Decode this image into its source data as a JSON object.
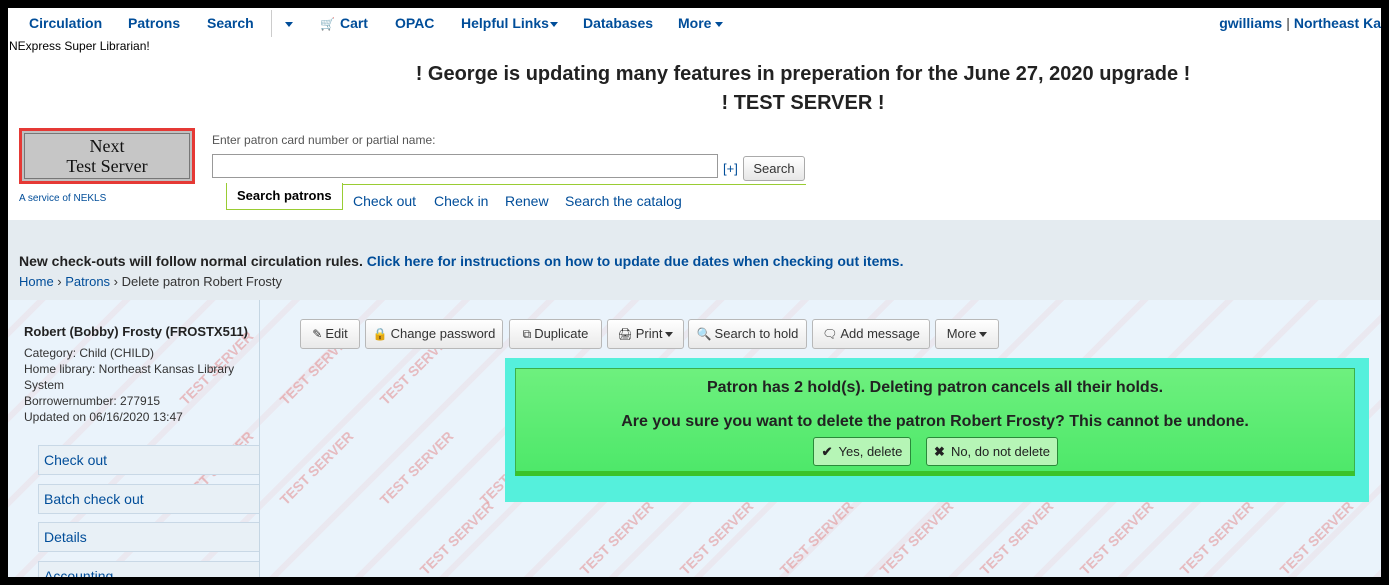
{
  "nav": {
    "circulation": "Circulation",
    "patrons": "Patrons",
    "search": "Search",
    "cart": "Cart",
    "opac": "OPAC",
    "helpful_links": "Helpful Links",
    "databases": "Databases",
    "more": "More",
    "user": "gwilliams",
    "library": "Northeast Ka"
  },
  "role": "NExpress Super Librarian!",
  "announcement": {
    "line1": "! George is updating many features in preperation for the June 27, 2020 upgrade !",
    "line2": "! TEST SERVER !"
  },
  "logo": {
    "line1": "Next",
    "line2": "Test Server",
    "service": "A service of NEKLS"
  },
  "search": {
    "label": "Enter patron card number or partial name:",
    "value": "",
    "plus": "[+]",
    "button": "Search",
    "tabs": [
      "Search patrons",
      "Check out",
      "Check in",
      "Renew",
      "Search the catalog"
    ]
  },
  "notice": {
    "text": "New check-outs will follow normal circulation rules.",
    "link": "Click here for instructions on how to update due dates when checking out items."
  },
  "breadcrumb": {
    "home": "Home",
    "patrons": "Patrons",
    "current": "Delete patron Robert Frosty"
  },
  "patron": {
    "name": "Robert (Bobby) Frosty (FROSTX511)",
    "category": "Category: Child (CHILD)",
    "home_library_1": "Home library: Northeast Kansas Library",
    "home_library_2": "System",
    "borrowernumber": "Borrowernumber: 277915",
    "updated": "Updated on 06/16/2020 13:47"
  },
  "sidebar": [
    "Check out",
    "Batch check out",
    "Details",
    "Accounting"
  ],
  "toolbar": {
    "edit": "Edit",
    "change_password": "Change password",
    "duplicate": "Duplicate",
    "print": "Print",
    "search_to_hold": "Search to hold",
    "add_message": "Add message",
    "more": "More"
  },
  "dialog": {
    "msg1": "Patron has 2 hold(s). Deleting patron cancels all their holds.",
    "msg2": "Are you sure you want to delete the patron Robert Frosty? This cannot be undone.",
    "yes": "Yes, delete",
    "no": "No, do not delete"
  },
  "watermark": "TEST SERVER"
}
